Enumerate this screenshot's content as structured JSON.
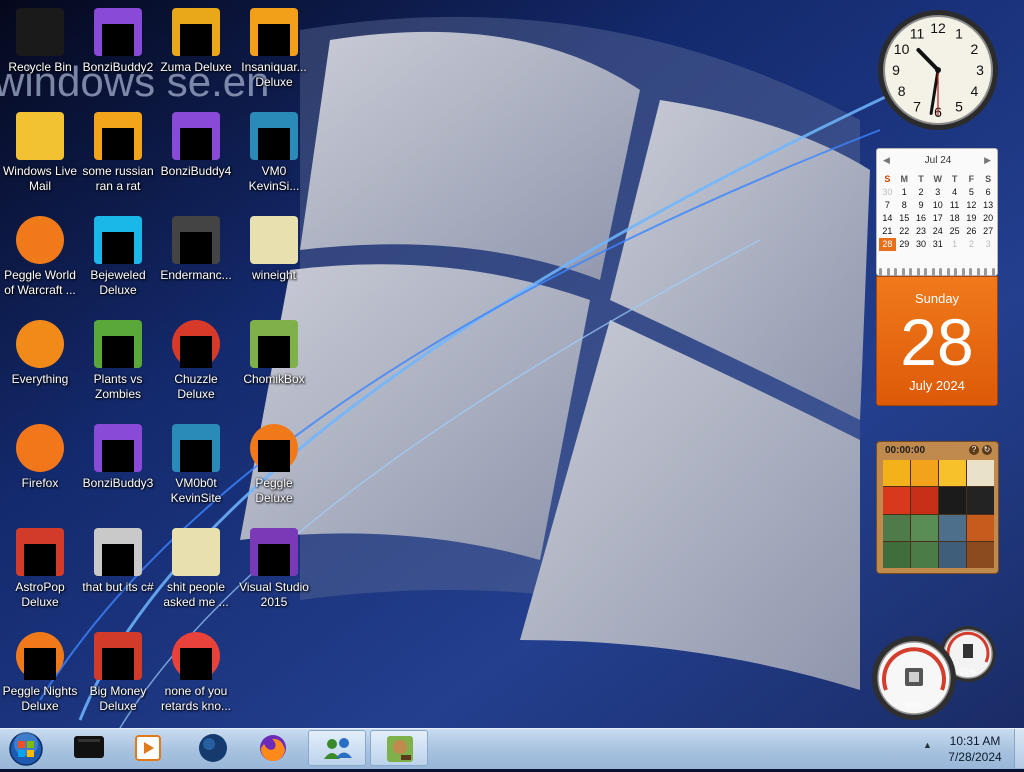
{
  "desktop": {
    "icons": [
      {
        "label": "Recycle Bin",
        "kind": "recycle"
      },
      {
        "label": "Windows Live Mail",
        "kind": "mail"
      },
      {
        "label": "Peggle World of Warcraft ...",
        "kind": "peggle"
      },
      {
        "label": "Everything",
        "kind": "everything"
      },
      {
        "label": "Firefox",
        "kind": "firefox"
      },
      {
        "label": "AstroPop Deluxe",
        "kind": "game"
      },
      {
        "label": "Peggle Nights Deluxe",
        "kind": "peggle"
      },
      {
        "label": "BonziBuddy2",
        "kind": "bonzi"
      },
      {
        "label": "some russian ran a rat",
        "kind": "file"
      },
      {
        "label": "Bejeweled Deluxe",
        "kind": "gem"
      },
      {
        "label": "Plants vs Zombies",
        "kind": "plant"
      },
      {
        "label": "BonziBuddy3",
        "kind": "bonzi"
      },
      {
        "label": "that but its c#",
        "kind": "stack"
      },
      {
        "label": "Big Money Deluxe",
        "kind": "game"
      },
      {
        "label": "Zuma Deluxe",
        "kind": "zuma"
      },
      {
        "label": "BonziBuddy4",
        "kind": "bonzi"
      },
      {
        "label": "Endermanc...",
        "kind": "window"
      },
      {
        "label": "Chuzzle Deluxe",
        "kind": "chuzzle"
      },
      {
        "label": "VM0b0t KevinSite",
        "kind": "vm"
      },
      {
        "label": "shit people asked me ...",
        "kind": "folder"
      },
      {
        "label": "none of you retards kno...",
        "kind": "ring"
      },
      {
        "label": "Insaniquar... Deluxe",
        "kind": "fish"
      },
      {
        "label": "VM0 KevinSi...",
        "kind": "vm"
      },
      {
        "label": "wineight",
        "kind": "folder"
      },
      {
        "label": "ChomikBox",
        "kind": "chomik"
      },
      {
        "label": "Peggle Deluxe",
        "kind": "peggle"
      },
      {
        "label": "Visual Studio 2015",
        "kind": "vs"
      }
    ]
  },
  "wallpaper": {
    "logo_text": "windows se.en"
  },
  "gadgets": {
    "clock": {
      "hour": 10,
      "minute": 31,
      "second": 30
    },
    "calendar": {
      "month_header": "Jul 24",
      "weekday_headers": [
        "S",
        "M",
        "T",
        "W",
        "T",
        "F",
        "S"
      ],
      "weeks": [
        [
          "30",
          "1",
          "2",
          "3",
          "4",
          "5",
          "6"
        ],
        [
          "7",
          "8",
          "9",
          "10",
          "11",
          "12",
          "13"
        ],
        [
          "14",
          "15",
          "16",
          "17",
          "18",
          "19",
          "20"
        ],
        [
          "21",
          "22",
          "23",
          "24",
          "25",
          "26",
          "27"
        ],
        [
          "28",
          "29",
          "30",
          "31",
          "1",
          "2",
          "3"
        ]
      ],
      "weekday": "Sunday",
      "day": "28",
      "month_year": "July 2024"
    },
    "puzzle": {
      "time": "00:00:00"
    },
    "meter": {
      "cpu": "00%",
      "memory": "21%"
    }
  },
  "taskbar": {
    "time": "10:31 AM",
    "date": "7/28/2024",
    "tray_arrow": "▲"
  },
  "colors": {
    "accent_orange": "#e8701a",
    "taskbar": "#b3cbe6"
  }
}
